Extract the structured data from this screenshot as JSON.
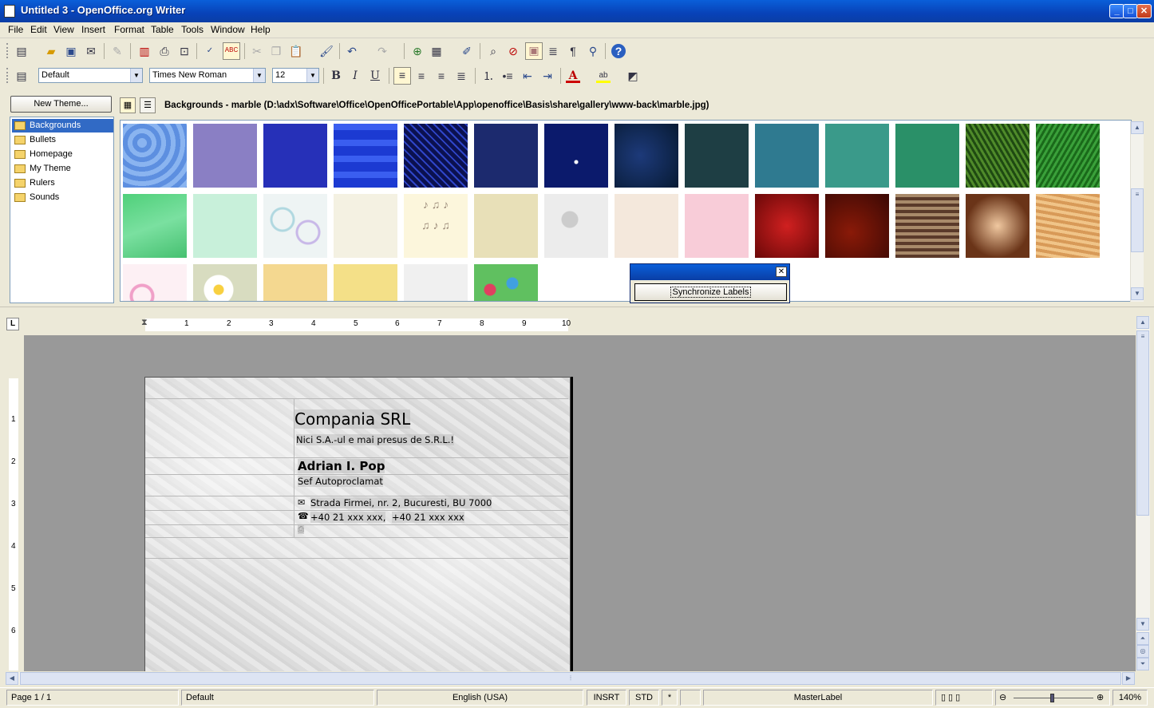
{
  "window": {
    "title": "Untitled 3 - OpenOffice.org Writer",
    "min": "_",
    "max": "□",
    "close": "✕"
  },
  "menu": [
    "File",
    "Edit",
    "View",
    "Insert",
    "Format",
    "Table",
    "Tools",
    "Window",
    "Help"
  ],
  "format_toolbar": {
    "style": "Default",
    "font": "Times New Roman",
    "size": "12",
    "bold": "B",
    "italic": "I",
    "underline": "U"
  },
  "gallery": {
    "new_theme_label": "New Theme...",
    "path": "Backgrounds - marble (D:\\adx\\Software\\Office\\OpenOfficePortable\\App\\openoffice\\Basis\\share\\gallery\\www-back\\marble.jpg)",
    "themes": [
      "Backgrounds",
      "Bullets",
      "Homepage",
      "My Theme",
      "Rulers",
      "Sounds"
    ],
    "selected_theme": "Backgrounds"
  },
  "sync": {
    "button_label": "Synchronize Labels"
  },
  "ruler": {
    "h": [
      "1",
      "2",
      "3",
      "4",
      "5",
      "6",
      "7",
      "8",
      "9",
      "10"
    ],
    "v": [
      "1",
      "2",
      "3",
      "4",
      "5",
      "6"
    ]
  },
  "document": {
    "company": "Compania SRL",
    "slogan": "Nici S.A.-ul e mai presus de S.R.L.!",
    "name": "Adrian I. Pop",
    "position": "Sef Autoproclamat",
    "address": "Strada Firmei, nr. 2, Bucuresti, BU 7000",
    "phones": "+40 21 xxx xxx, ",
    "phone2": "+40 21 xxx xxx"
  },
  "status": {
    "page": "Page 1 / 1",
    "style": "Default",
    "language": "English (USA)",
    "insert_mode": "INSRT",
    "selection_mode": "STD",
    "modified": "*",
    "context": "MasterLabel",
    "zoom": "140%"
  }
}
